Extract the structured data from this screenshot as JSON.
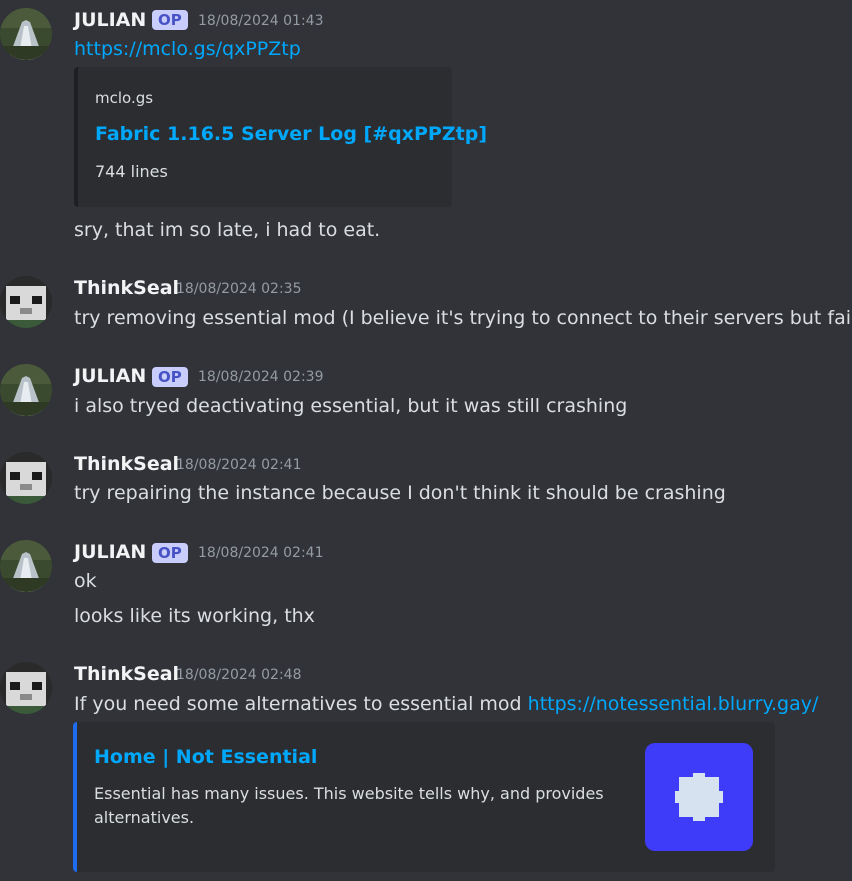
{
  "messages": [
    {
      "author": "JULIAN",
      "badge": "OP",
      "timestamp": "18/08/2024 01:43",
      "link": "https://mclo.gs/qxPPZtp",
      "embed": {
        "provider": "mclo.gs",
        "title": "Fabric 1.16.5 Server Log [#qxPPZtp]",
        "description": "744 lines"
      },
      "extra": "sry, that im so late, i had to eat."
    },
    {
      "author": "ThinkSeal",
      "timestamp": "18/08/2024 02:35",
      "text": "try removing essential mod (I believe it's trying to connect to their servers but failing)"
    },
    {
      "author": "JULIAN",
      "badge": "OP",
      "timestamp": "18/08/2024 02:39",
      "text": "i also tryed deactivating essential, but it was still crashing"
    },
    {
      "author": "ThinkSeal",
      "timestamp": "18/08/2024 02:41",
      "text": "try repairing the instance because I don't think it should be crashing"
    },
    {
      "author": "JULIAN",
      "badge": "OP",
      "timestamp": "18/08/2024 02:41",
      "text": "ok",
      "extra": "looks like its working, thx"
    },
    {
      "author": "ThinkSeal",
      "timestamp": "18/08/2024 02:48",
      "text": "If you need some alternatives to essential mod",
      "link": "https://notessential.blurry.gay/",
      "embed": {
        "title": "Home | Not Essential",
        "description_line1": "Essential has many issues. This website tells why, and provides",
        "description_line2": "alternatives."
      }
    }
  ],
  "colors": {
    "background": "#313338",
    "link": "#00a8fc",
    "op_badge": "#c9cdfb",
    "embed_accent": "#1e6cf0",
    "thumb": "#3f3cf9"
  },
  "icons": {
    "avatar_julian": "waterfall-avatar",
    "avatar_thinkseal": "seal-avatar",
    "thumb": "puzzle-icon"
  }
}
